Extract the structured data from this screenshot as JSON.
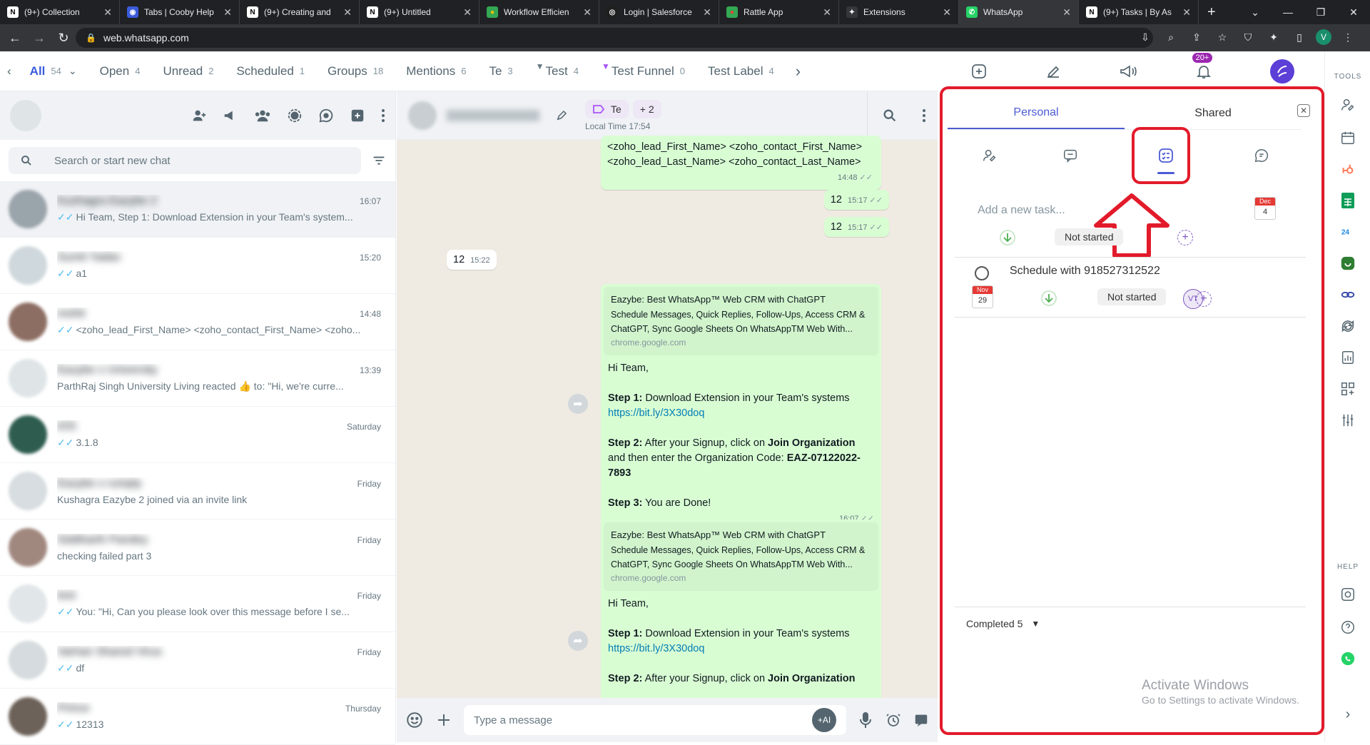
{
  "browser": {
    "tabs": [
      {
        "title": "(9+) Collection",
        "fav": "N",
        "favbg": "#ffffff",
        "favfg": "#000000"
      },
      {
        "title": "Tabs | Cooby Help",
        "fav": "◉",
        "favbg": "#3b5bdb",
        "favfg": "#ffffff"
      },
      {
        "title": "(9+) Creating and",
        "fav": "N",
        "favbg": "#ffffff",
        "favfg": "#000000"
      },
      {
        "title": "(9+) Untitled",
        "fav": "N",
        "favbg": "#ffffff",
        "favfg": "#000000"
      },
      {
        "title": "Workflow Efficien",
        "fav": "●",
        "favbg": "#34a853",
        "favfg": "#fbbc05"
      },
      {
        "title": "Login | Salesforce",
        "fav": "◎",
        "favbg": "#1f1f1f",
        "favfg": "#ffffff"
      },
      {
        "title": "Rattle App",
        "fav": "●",
        "favbg": "#34a853",
        "favfg": "#ea4335"
      },
      {
        "title": "Extensions",
        "fav": "✦",
        "favbg": "#35363a",
        "favfg": "#ffffff"
      },
      {
        "title": "WhatsApp",
        "fav": "✆",
        "favbg": "#25d366",
        "favfg": "#ffffff",
        "active": true
      },
      {
        "title": "(9+) Tasks | By As",
        "fav": "N",
        "favbg": "#ffffff",
        "favfg": "#000000"
      }
    ],
    "new_tab": "+",
    "url": "web.whatsapp.com",
    "profile_initial": "V"
  },
  "filters": {
    "tabs": [
      {
        "label": "All",
        "count": "54",
        "active": true
      },
      {
        "label": "Open",
        "count": "4"
      },
      {
        "label": "Unread",
        "count": "2"
      },
      {
        "label": "Scheduled",
        "count": "1"
      },
      {
        "label": "Groups",
        "count": "18"
      },
      {
        "label": "Mentions",
        "count": "6"
      },
      {
        "label": "Te",
        "count": "3"
      },
      {
        "label": "Test",
        "count": "4"
      },
      {
        "label": "Test Funnel",
        "count": "0"
      },
      {
        "label": "Test Label",
        "count": "4"
      }
    ],
    "notification_badge": "20+"
  },
  "sidebar": {
    "search_placeholder": "Search or start new chat",
    "chats": [
      {
        "name": "Kushagra Eazybe 2",
        "time": "16:07",
        "msg": "Hi Team,  Step 1: Download Extension in your Team's system...",
        "tick": true,
        "selected": true
      },
      {
        "name": "Sumit Yadav",
        "time": "15:20",
        "msg": "a1",
        "tick": true
      },
      {
        "name": "mohit",
        "time": "14:48",
        "msg": "<zoho_lead_First_Name> <zoho_contact_First_Name> <zoho...",
        "tick": true
      },
      {
        "name": "Eazybe x University Living",
        "time": "13:39",
        "msg": "ParthRaj Singh University Living reacted 👍 to: \"Hi, we're curre...",
        "tick": false
      },
      {
        "name": "iOS",
        "time": "Saturday",
        "msg": "3.1.8",
        "tick": true
      },
      {
        "name": "Eazybe x rumply",
        "time": "Friday",
        "msg": "Kushagra Eazybe 2 joined via an invite link",
        "tick": false
      },
      {
        "name": "Siddharth Pandey",
        "time": "Friday",
        "msg": "checking failed part 3",
        "tick": false
      },
      {
        "name": "test",
        "time": "Friday",
        "msg": "You: \"Hi,  Can you please look over this message before I se...",
        "tick": true
      },
      {
        "name": "Varhan Shared Virus",
        "time": "Friday",
        "msg": "df",
        "tick": true
      },
      {
        "name": "Prince",
        "time": "Thursday",
        "msg": "12313",
        "tick": true
      }
    ]
  },
  "conversation": {
    "header_name": "Kushagra Eazyb...",
    "label_pill": "Te",
    "more_labels": "+ 2",
    "local_time": "Local Time 17:54",
    "zoho_line1": "<zoho_lead_First_Name> <zoho_contact_First_Name>",
    "zoho_line2": "<zoho_lead_Last_Name> <zoho_contact_Last_Name>",
    "zoho_time": "14:48",
    "out_12a": "12",
    "out_12a_time": "15:17",
    "out_12b": "12",
    "out_12b_time": "15:17",
    "in_12": "12",
    "in_12_time": "15:22",
    "card_title": "Eazybe: Best WhatsApp™ Web CRM with ChatGPT",
    "card_desc": "Schedule Messages, Quick Replies, Follow-Ups, Access CRM & ChatGPT, Sync Google Sheets On WhatsAppTM Web With...",
    "card_domain": "chrome.google.com",
    "greeting": "Hi Team,",
    "step1_label": "Step 1:",
    "step1_text": " Download Extension in your Team's systems",
    "link": "https://bit.ly/3X30doq",
    "step2_label": "Step 2:",
    "step2_text_a": " After your Signup, click on ",
    "join_org": "Join Organization",
    "step2_text_b": " and then enter the Organization Code: ",
    "org_code": "EAZ-07122022-7893",
    "step3_label": "Step 3:",
    "step3_text": " You are Done!",
    "msg_time": "16:07",
    "composer_placeholder": "Type a message",
    "ai_label": "+AI"
  },
  "panel": {
    "tab_personal": "Personal",
    "tab_shared": "Shared",
    "add_task_placeholder": "Add a new task...",
    "new_status": "Not started",
    "new_cal_month": "Dec",
    "new_cal_day": "4",
    "task_title": "Schedule with 918527312522",
    "task_cal_month": "Nov",
    "task_cal_day": "29",
    "task_status": "Not started",
    "assignee_initials": "VT",
    "completed": "Completed 5",
    "watermark_title": "Activate Windows",
    "watermark_sub": "Go to Settings to activate Windows."
  },
  "rail": {
    "tools_label": "TOOLS",
    "help_label": "HELP"
  },
  "colors": {
    "accent": "#4c5bd4",
    "highlight_red": "#e21b2b",
    "outgoing_bubble": "#d9fdd3"
  }
}
